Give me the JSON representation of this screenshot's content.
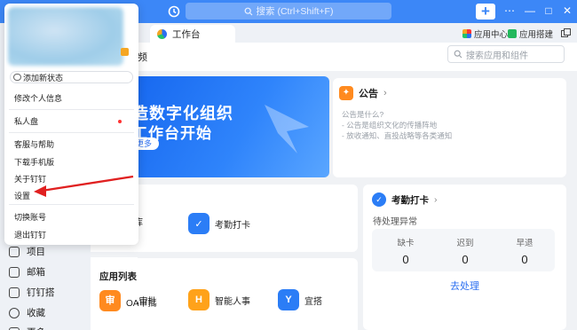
{
  "topbar": {
    "search_placeholder": "搜索 (Ctrl+Shift+F)",
    "plus_label": "+",
    "window_controls": [
      "⋯",
      "—",
      "□",
      "✕"
    ]
  },
  "tabbar": {
    "active_tab": "工作台",
    "app_center": "应用中心",
    "app_builder": "应用搭建"
  },
  "content": {
    "header_title": "频",
    "app_search_placeholder": "搜索应用和组件",
    "banner": {
      "line1": "造数字化组织",
      "line2": "工作台开始",
      "button": "更多"
    },
    "notice": {
      "title": "公告",
      "lines": [
        "公告是什么?",
        "- 公告是组织文化的传播阵地",
        "- 放收通知、直投战略等各类通知"
      ]
    },
    "favorites": {
      "items": [
        {
          "label": "知识库",
          "visible_text": "库"
        },
        {
          "label": "考勤打卡",
          "visible_text": "考勤打卡"
        }
      ]
    },
    "attendance": {
      "title": "考勤打卡",
      "subtitle": "待处理异常",
      "stats": [
        {
          "label": "缺卡",
          "value": "0"
        },
        {
          "label": "迟到",
          "value": "0"
        },
        {
          "label": "早退",
          "value": "0"
        }
      ],
      "action": "去处理"
    },
    "app_list": {
      "title": "应用列表",
      "items": [
        {
          "label": "OA审批",
          "icon_text": "审"
        },
        {
          "label": "智能人事",
          "icon_text": "H"
        },
        {
          "label": "宜搭",
          "icon_text": "Y"
        }
      ]
    }
  },
  "sidebar": {
    "items": [
      "项目",
      "邮箱",
      "钉钉搭",
      "收藏",
      "更多"
    ]
  },
  "popup": {
    "status_button": "添加新状态",
    "menu": {
      "edit_profile": "修改个人信息",
      "private_disk": "私人盘",
      "help": "客服与帮助",
      "download_mobile": "下载手机版",
      "about": "关于钉钉",
      "settings": "设置",
      "switch_account": "切换账号",
      "logout": "退出钉钉"
    }
  },
  "colors": {
    "brand_blue": "#3c87f7",
    "annotation_red": "#e02020",
    "notice_orange": "#ff8a1f"
  }
}
